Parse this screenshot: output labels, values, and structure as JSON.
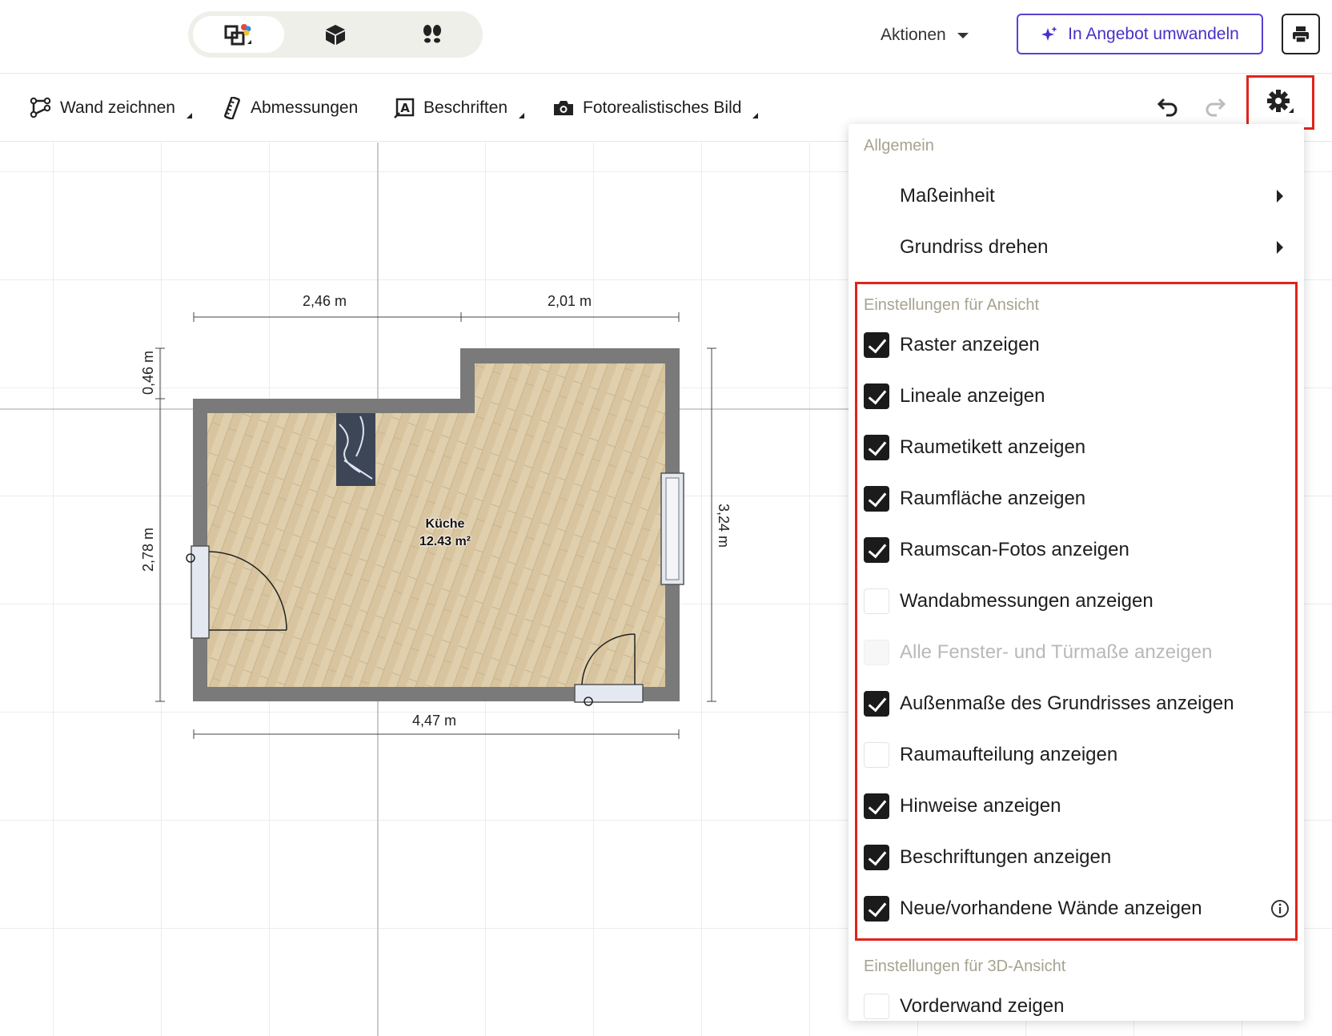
{
  "header": {
    "view_modes": [
      {
        "name": "2d-floorplan",
        "icon": "floorplan-2d-icon",
        "active": true
      },
      {
        "name": "3d",
        "icon": "cube-3d-icon",
        "active": false
      },
      {
        "name": "walkthrough",
        "icon": "footsteps-icon",
        "active": false
      }
    ],
    "actions_label": "Aktionen",
    "offer_button_label": "In Angebot umwandeln",
    "print_icon": "printer-icon"
  },
  "toolbar": {
    "draw_wall": "Wand zeichnen",
    "dimensions": "Abmessungen",
    "labels": "Beschriften",
    "photo_image": "Fotorealistisches Bild",
    "undo_icon": "undo-icon",
    "redo_icon": "redo-icon",
    "settings_icon": "gear-icon"
  },
  "floorplan": {
    "room_name": "Küche",
    "room_area": "12.43 m²",
    "dims": {
      "top_left": "2,46 m",
      "top_right": "2,01 m",
      "left_small": "0,46 m",
      "left_main": "2,78 m",
      "right": "3,24 m",
      "bottom": "4,47 m"
    }
  },
  "settings_menu": {
    "general_title": "Allgemein",
    "general_items": [
      {
        "label": "Maßeinheit"
      },
      {
        "label": "Grundriss drehen"
      }
    ],
    "view_title": "Einstellungen für Ansicht",
    "view_items": [
      {
        "label": "Raster anzeigen",
        "checked": true
      },
      {
        "label": "Lineale anzeigen",
        "checked": true
      },
      {
        "label": "Raumetikett anzeigen",
        "checked": true
      },
      {
        "label": "Raumfläche anzeigen",
        "checked": true
      },
      {
        "label": "Raumscan-Fotos anzeigen",
        "checked": true
      },
      {
        "label": "Wandabmessungen anzeigen",
        "checked": false
      },
      {
        "label": "Alle Fenster- und Türmaße anzeigen",
        "checked": false,
        "disabled": true
      },
      {
        "label": "Außenmaße des Grundrisses anzeigen",
        "checked": true
      },
      {
        "label": "Raumaufteilung anzeigen",
        "checked": false
      },
      {
        "label": "Hinweise anzeigen",
        "checked": true
      },
      {
        "label": "Beschriftungen anzeigen",
        "checked": true
      },
      {
        "label": "Neue/vorhandene Wände anzeigen",
        "checked": true,
        "info_icon": "info-icon"
      }
    ],
    "view3d_title": "Einstellungen für 3D-Ansicht",
    "view3d_items": [
      {
        "label": "Vorderwand zeigen",
        "checked": false
      }
    ]
  },
  "colors": {
    "accent": "#5b3fd6",
    "highlight": "#e0241b",
    "wall": "#7a7a7a",
    "floor": "#d9c7a4"
  }
}
